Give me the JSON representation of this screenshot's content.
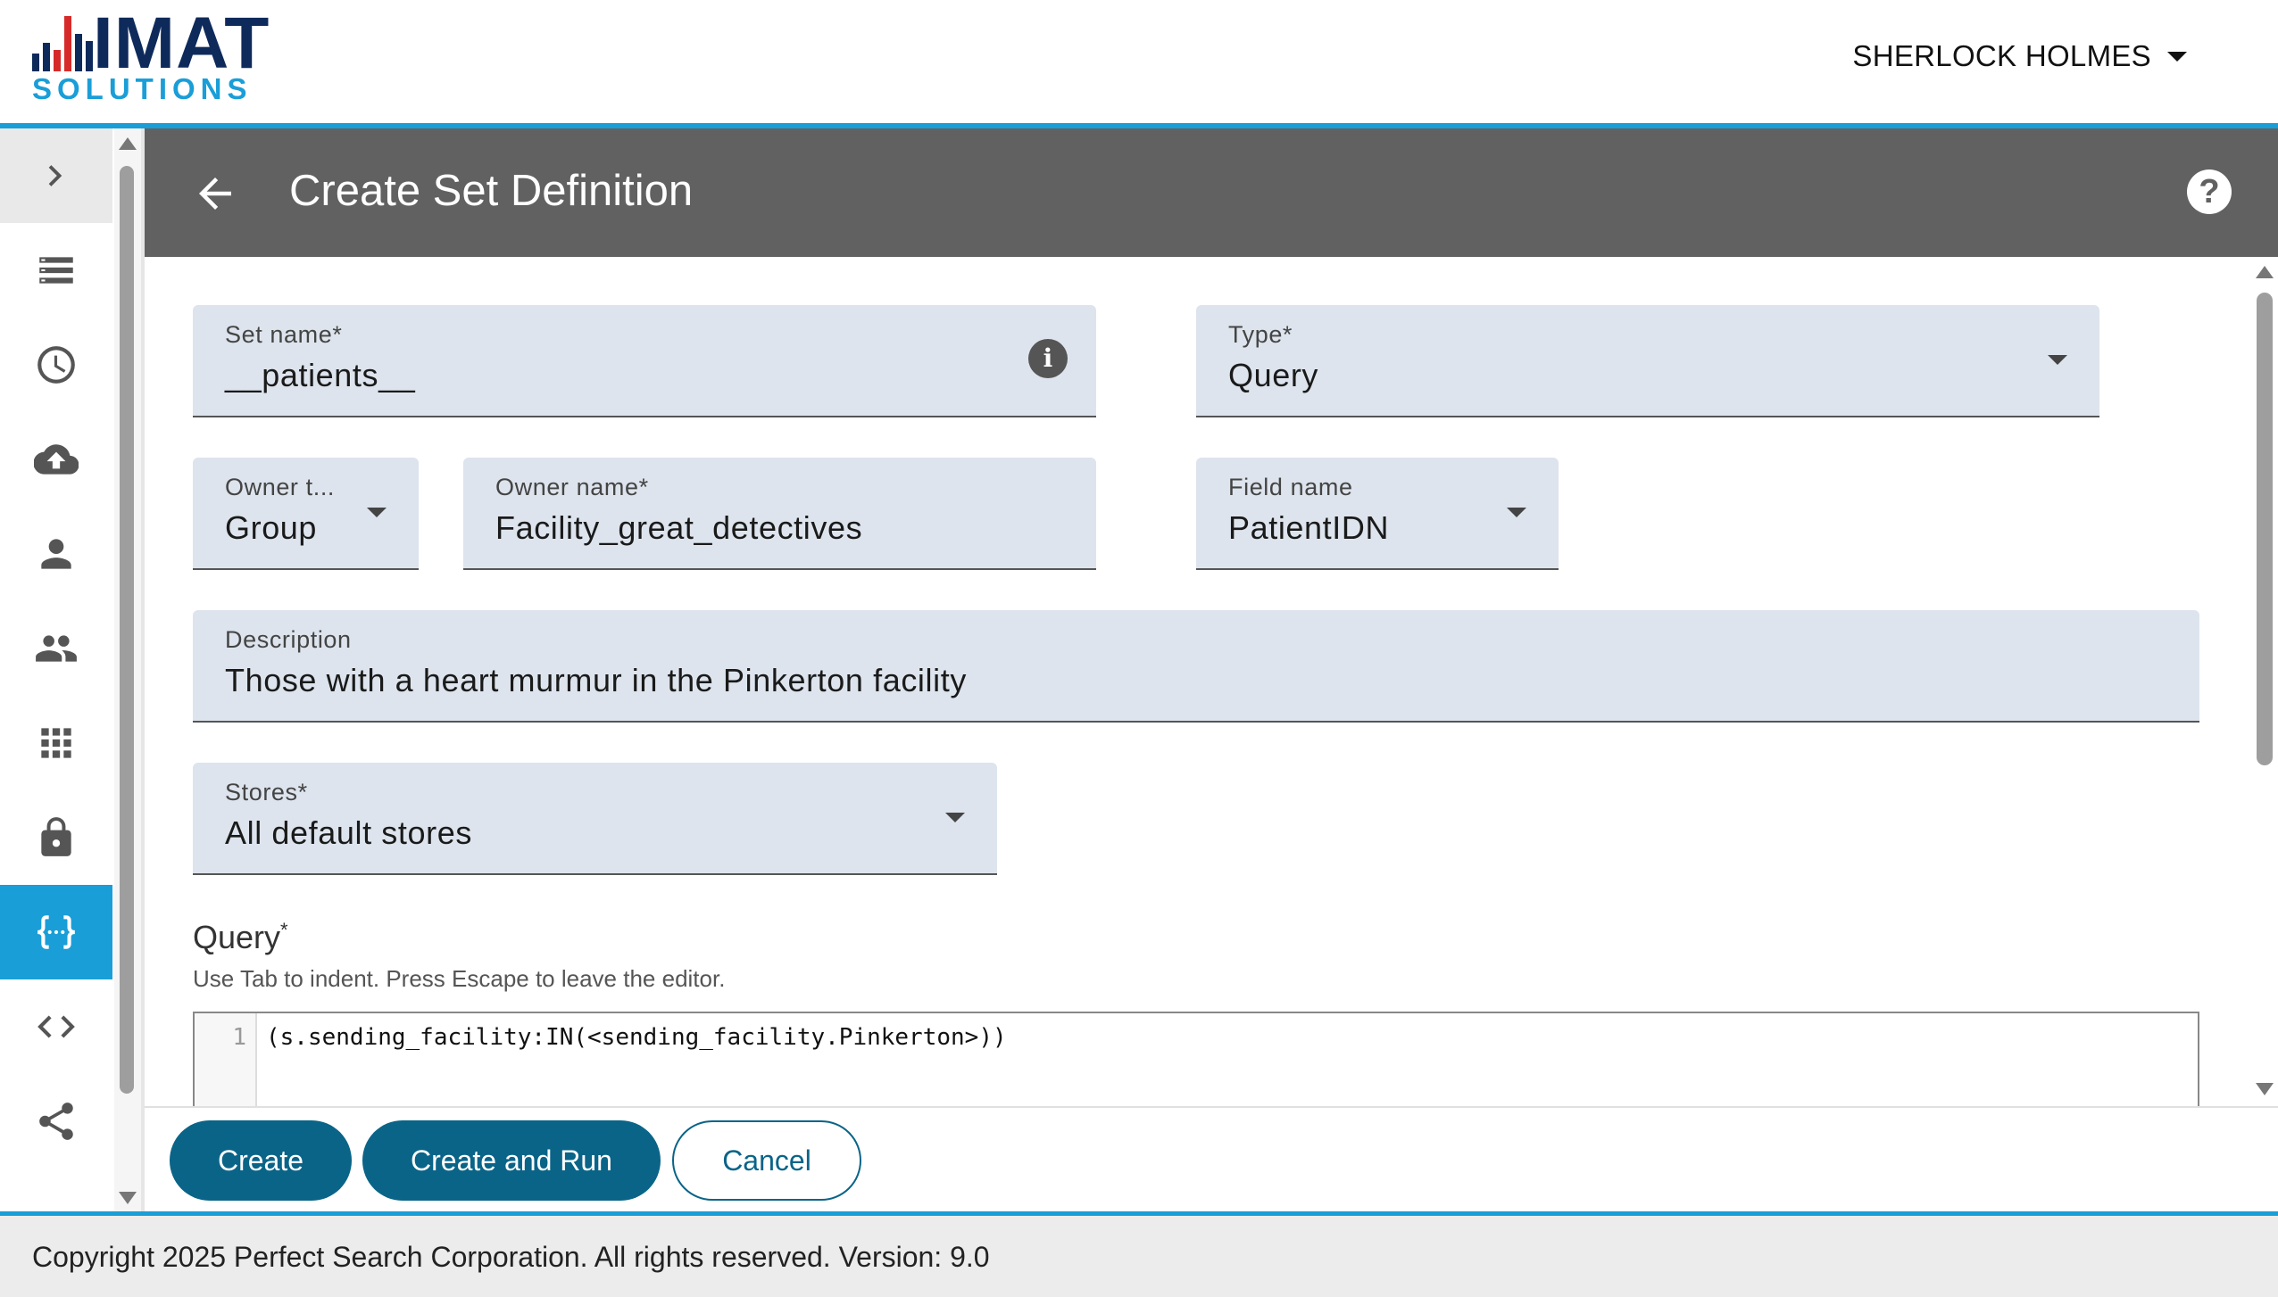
{
  "header": {
    "logo_main": "IMAT",
    "logo_sub": "SOLUTIONS",
    "user_name": "SHERLOCK HOLMES",
    "accent_color": "#1a9ed8"
  },
  "sidebar": {
    "items": [
      {
        "icon": "chevron-right-icon",
        "active": false
      },
      {
        "icon": "list-icon",
        "active": false
      },
      {
        "icon": "clock-icon",
        "active": false
      },
      {
        "icon": "cloud-upload-icon",
        "active": false
      },
      {
        "icon": "person-icon",
        "active": false
      },
      {
        "icon": "people-icon",
        "active": false
      },
      {
        "icon": "apps-grid-icon",
        "active": false
      },
      {
        "icon": "lock-icon",
        "active": false
      },
      {
        "icon": "braces-icon",
        "active": true
      },
      {
        "icon": "code-icon",
        "active": false
      },
      {
        "icon": "share-icon",
        "active": false
      }
    ]
  },
  "page": {
    "title": "Create Set Definition",
    "back_icon": "arrow-left-icon",
    "help_icon": "help-icon",
    "help_glyph": "?"
  },
  "form": {
    "set_name": {
      "label": "Set name*",
      "value": "__patients__",
      "icon": "info-icon"
    },
    "type": {
      "label": "Type*",
      "value": "Query"
    },
    "owner_type": {
      "label": "Owner t...",
      "value": "Group"
    },
    "owner_name": {
      "label": "Owner name*",
      "value": "Facility_great_detectives"
    },
    "field_name": {
      "label": "Field name",
      "value": "PatientIDN"
    },
    "description": {
      "label": "Description",
      "value": "Those with a heart murmur in the Pinkerton facility"
    },
    "stores": {
      "label": "Stores*",
      "value": "All default stores"
    },
    "query": {
      "label": "Query",
      "required_mark": "*",
      "hint": "Use Tab to indent. Press Escape to leave the editor.",
      "lines": [
        {
          "number": "1",
          "code": "(s.sending_facility:IN(<sending_facility.Pinkerton>))"
        }
      ]
    }
  },
  "actions": {
    "create": "Create",
    "create_and_run": "Create and Run",
    "cancel": "Cancel",
    "primary_color": "#0a6488"
  },
  "footer": {
    "text": "Copyright 2025 Perfect Search Corporation. All rights reserved. Version: 9.0"
  }
}
